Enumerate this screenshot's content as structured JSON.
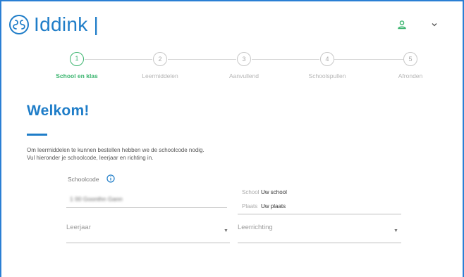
{
  "header": {
    "logo_text": "Iddink",
    "logo_bar": "|",
    "user_icon": "user-icon",
    "menu_icon": "chevron-down-icon",
    "brand_color": "#1f7dc8"
  },
  "stepper": {
    "active_color": "#3bb56f",
    "steps": [
      {
        "number": "1",
        "label": "School en klas",
        "active": true
      },
      {
        "number": "2",
        "label": "Leermiddelen",
        "active": false
      },
      {
        "number": "3",
        "label": "Aanvullend",
        "active": false
      },
      {
        "number": "4",
        "label": "Schoolspullen",
        "active": false
      },
      {
        "number": "5",
        "label": "Afronden",
        "active": false
      }
    ]
  },
  "main": {
    "title": "Welkom!",
    "intro_line1": "Om leermiddelen te kunnen bestellen hebben we de schoolcode nodig.",
    "intro_line2": "Vul hieronder je schoolcode, leerjaar en richting in.",
    "schoolcode_label": "Schoolcode",
    "schoolcode_value": "1 00 Goonthn Gann",
    "school_key": "School",
    "school_value": "Uw school",
    "plaats_key": "Plaats",
    "plaats_value": "Uw plaats",
    "leerjaar_label": "Leerjaar",
    "leerrichting_label": "Leerrichting"
  }
}
